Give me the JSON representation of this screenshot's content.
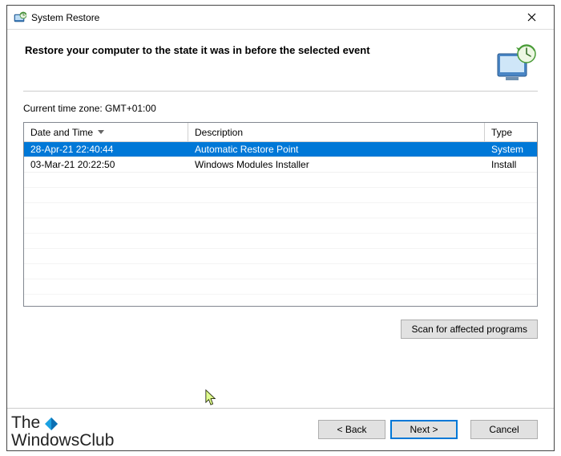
{
  "window": {
    "title": "System Restore"
  },
  "header": {
    "heading": "Restore your computer to the state it was in before the selected event"
  },
  "content": {
    "timezone_label": "Current time zone: GMT+01:00",
    "columns": {
      "date": "Date and Time",
      "desc": "Description",
      "type": "Type"
    },
    "rows": [
      {
        "date": "28-Apr-21 22:40:44",
        "desc": "Automatic Restore Point",
        "type": "System",
        "selected": true
      },
      {
        "date": "03-Mar-21 20:22:50",
        "desc": "Windows Modules Installer",
        "type": "Install",
        "selected": false
      }
    ],
    "scan_button": "Scan for affected programs"
  },
  "footer": {
    "back": "< Back",
    "next": "Next >",
    "cancel": "Cancel"
  },
  "watermark": {
    "line1": "The",
    "line2": "WindowsClub"
  }
}
